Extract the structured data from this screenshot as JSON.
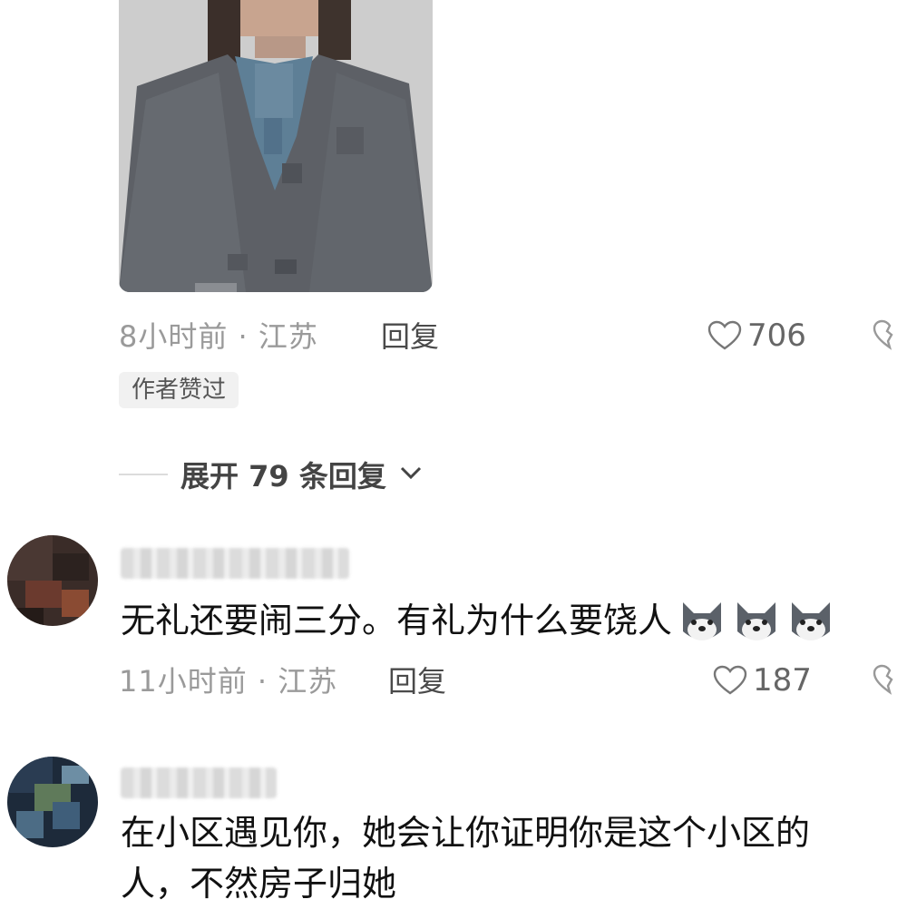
{
  "comments": [
    {
      "time": "8小时前",
      "location": "江苏",
      "reply_label": "回复",
      "likes": "706",
      "badge": "作者赞过",
      "expand_label": "展开 79 条回复"
    },
    {
      "text": "无礼还要闹三分。有礼为什么要饶人",
      "emoji_count": 3,
      "emoji_icon": "husky-dog-emoji",
      "time": "11小时前",
      "location": "江苏",
      "reply_label": "回复",
      "likes": "187"
    },
    {
      "text_line1": "在小区遇见你，她会让你证明你是这个小区的",
      "text_line2": "人，不然房子归她"
    }
  ],
  "separator": "·",
  "colors": {
    "meta": "#9a9a9a",
    "badge_bg": "#f1f1f1"
  }
}
